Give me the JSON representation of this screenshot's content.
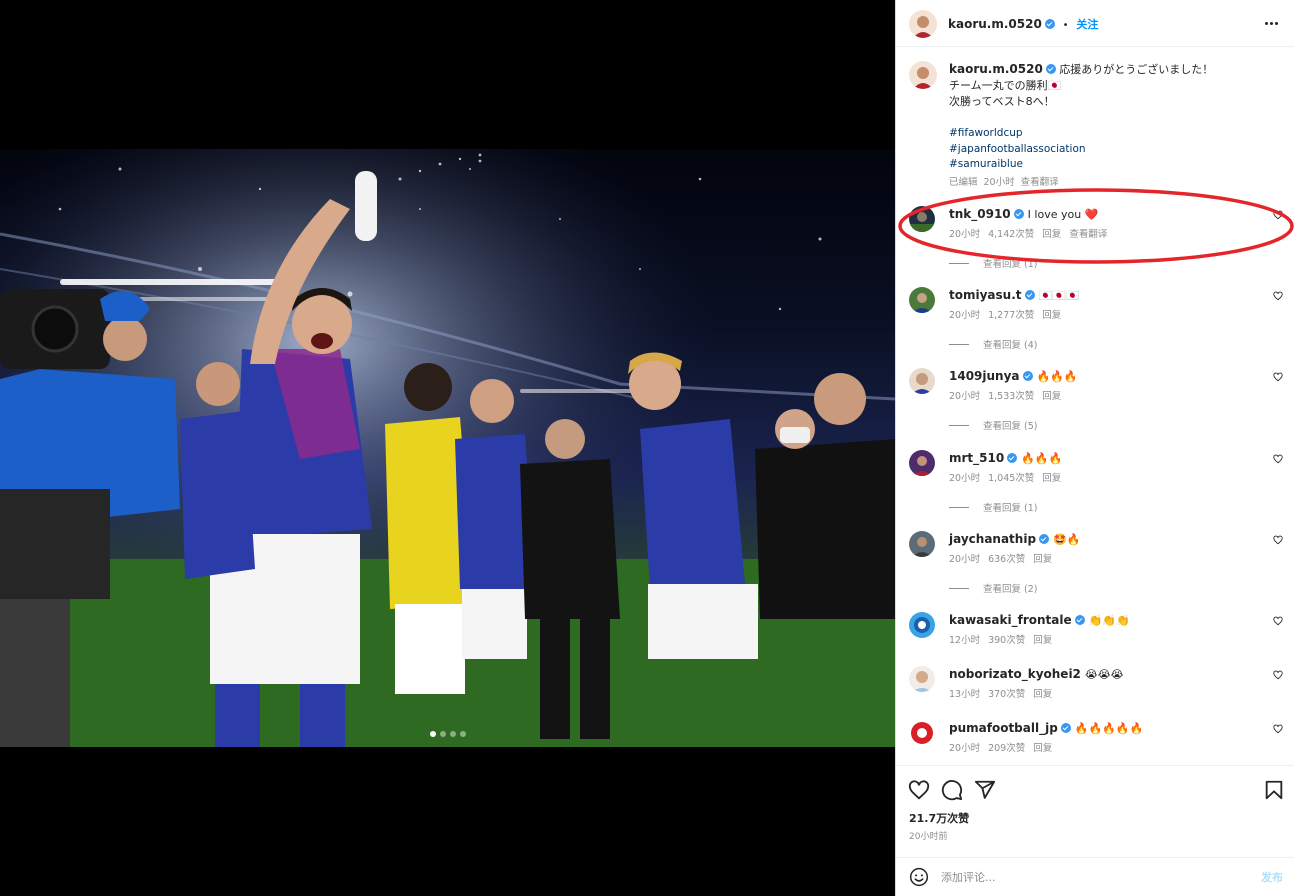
{
  "post": {
    "author": "kaoru.m.0520",
    "follow_label": "关注",
    "separator": "•"
  },
  "caption": {
    "author": "kaoru.m.0520",
    "lines": [
      "応援ありがとうございました！",
      "チーム一丸での勝利🇯🇵",
      "次勝ってベスト8へ！"
    ],
    "hashtags": [
      "#fifaworldcup",
      "#japanfootballassociation",
      "#samuraiblue"
    ],
    "edited": "已编辑",
    "time": "20小时",
    "translate": "查看翻译"
  },
  "comments": [
    {
      "user": "tnk_0910",
      "verified": true,
      "text": "I love you ❤️",
      "time": "20小时",
      "likes": "4,142次赞",
      "reply": "回复",
      "translate": "查看翻译",
      "replies": "查看回复 (1)"
    },
    {
      "user": "tomiyasu.t",
      "verified": true,
      "text": "🇯🇵🇯🇵🇯🇵",
      "time": "20小时",
      "likes": "1,277次赞",
      "reply": "回复",
      "replies": "查看回复 (4)"
    },
    {
      "user": "1409junya",
      "verified": true,
      "text": "🔥🔥🔥",
      "time": "20小时",
      "likes": "1,533次赞",
      "reply": "回复",
      "replies": "查看回复 (5)"
    },
    {
      "user": "mrt_510",
      "verified": true,
      "text": "🔥🔥🔥",
      "time": "20小时",
      "likes": "1,045次赞",
      "reply": "回复",
      "replies": "查看回复 (1)"
    },
    {
      "user": "jaychanathip",
      "verified": true,
      "text": "🤩🔥",
      "time": "20小时",
      "likes": "636次赞",
      "reply": "回复",
      "replies": "查看回复 (2)"
    },
    {
      "user": "kawasaki_frontale",
      "verified": true,
      "text": "👏👏👏",
      "time": "12小时",
      "likes": "390次赞",
      "reply": "回复"
    },
    {
      "user": "noborizato_kyohei2",
      "verified": false,
      "text": "😭😭😭",
      "time": "13小时",
      "likes": "370次赞",
      "reply": "回复"
    },
    {
      "user": "pumafootball_jp",
      "verified": true,
      "text": "🔥🔥🔥🔥🔥",
      "time": "20小时",
      "likes": "209次赞",
      "reply": "回复"
    }
  ],
  "actions": {
    "likes": "21.7万次赞",
    "posted": "20小时前"
  },
  "composer": {
    "placeholder": "添加评论...",
    "post_label": "发布"
  },
  "colors": {
    "link_blue": "#0095f6",
    "verified_blue": "#3897f0",
    "annotation_red": "#e4262a",
    "heart_red": "#ed4956"
  },
  "icons": [
    "more-icon",
    "heart-icon",
    "comment-icon",
    "share-icon",
    "bookmark-icon",
    "emoji-icon",
    "verified-badge-icon"
  ]
}
